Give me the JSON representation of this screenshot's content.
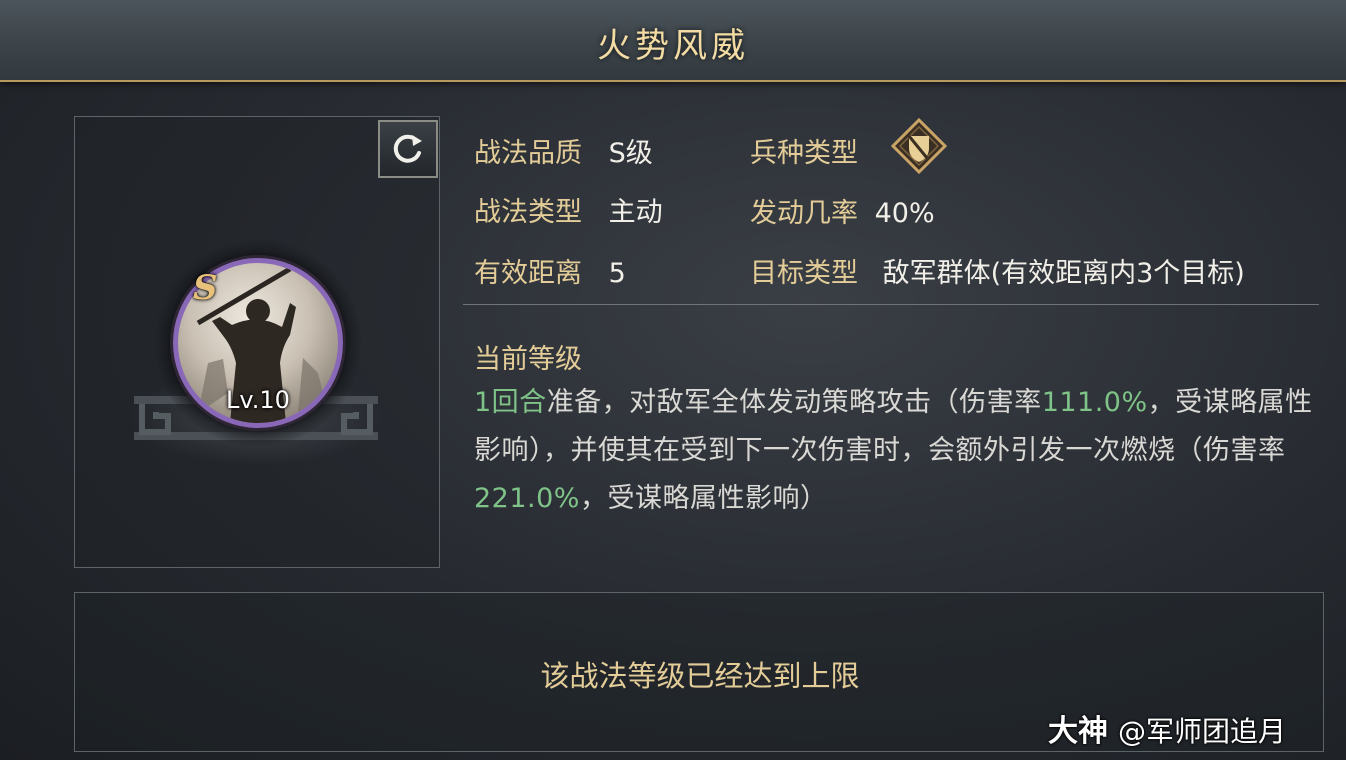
{
  "header": {
    "title": "火势风威"
  },
  "skill_card": {
    "grade_badge": "S",
    "level": "Lv.10",
    "refresh_icon": "refresh-icon",
    "portrait_icon": "warrior-portrait-icon"
  },
  "attributes": {
    "quality_label": "战法品质",
    "quality_value": "S级",
    "troop_type_label": "兵种类型",
    "troop_type_icon": "shield-troop-icon",
    "skill_type_label": "战法类型",
    "skill_type_value": "主动",
    "trigger_rate_label": "发动几率",
    "trigger_rate_value": "40%",
    "range_label": "有效距离",
    "range_value": "5",
    "target_label": "目标类型",
    "target_value": "敌军群体(有效距离内3个目标)"
  },
  "current_level": {
    "heading": "当前等级",
    "desc_turns": "1回合",
    "desc_part1": "准备，对敌军全体发动策略攻击（伤害率",
    "desc_rate1": "111.0%",
    "desc_part2": "，受谋略属性影响），并使其在受到下一次伤害时，会额外引发一次燃烧（伤害率",
    "desc_rate2": "221.0%",
    "desc_part3": "，受谋略属性影响）"
  },
  "footer": {
    "max_level_text": "该战法等级已经达到上限"
  },
  "watermark": {
    "brand": "大神",
    "handle": "@军师团追月"
  },
  "colors": {
    "gold_label": "#e3cc97",
    "highlight_green": "#7fc388",
    "avatar_ring": "#8a68b8"
  }
}
